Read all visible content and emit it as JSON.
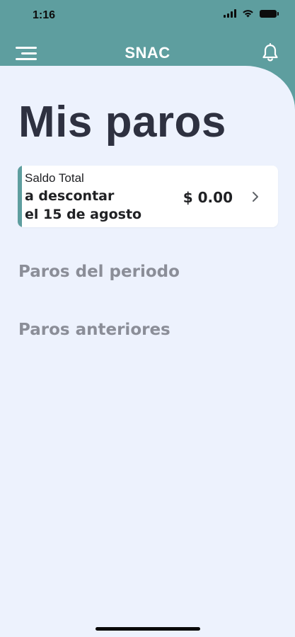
{
  "status_bar": {
    "time": "1:16",
    "icons": [
      "signal-icon",
      "wifi-icon",
      "battery-icon"
    ]
  },
  "nav": {
    "title": "SNAC",
    "menu_icon": "hamburger-menu-icon",
    "notifications_icon": "bell-icon"
  },
  "page": {
    "title": "Mis paros"
  },
  "balance_card": {
    "label": "Saldo Total",
    "line1": "a descontar",
    "line2": "el 15 de agosto",
    "amount": "$ 0.00",
    "chevron_icon": "chevron-right-icon"
  },
  "sections": [
    {
      "title": "Paros del periodo"
    },
    {
      "title": "Paros anteriores"
    }
  ],
  "colors": {
    "brand_teal": "#5e9e9f",
    "background": "#edf2fd",
    "title_text": "#2e3140",
    "muted_text": "#8b8e98",
    "card": "#ffffff"
  }
}
